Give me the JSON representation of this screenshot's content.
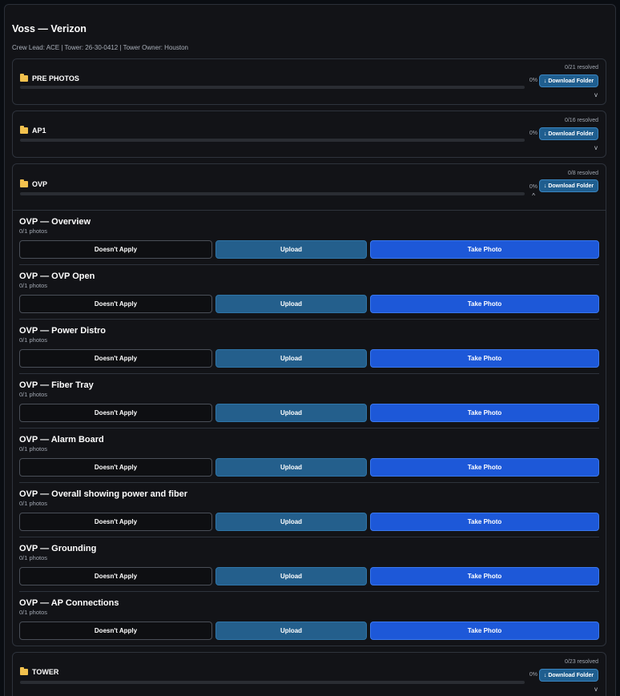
{
  "job": {
    "title": "Voss — Verizon",
    "meta": "Crew Lead: ACE | Tower: 26-30-0412 | Tower Owner: Houston"
  },
  "common": {
    "download_label": "↓ Download Folder",
    "doesnt_apply_label": "Doesn't Apply",
    "upload_label": "Upload",
    "take_photo_label": "Take Photo"
  },
  "folders": [
    {
      "name": "PRE PHOTOS",
      "resolved": "0/21 resolved",
      "percent": "0%",
      "progress": 0,
      "chevron": "v"
    },
    {
      "name": "AP1",
      "resolved": "0/16 resolved",
      "percent": "0%",
      "progress": 0,
      "chevron": "v"
    },
    {
      "name": "OVP",
      "resolved": "0/8 resolved",
      "percent": "0%",
      "progress": 0,
      "chevron": "^",
      "items": [
        {
          "title": "OVP — Overview",
          "count": "0/1 photos"
        },
        {
          "title": "OVP — OVP Open",
          "count": "0/1 photos"
        },
        {
          "title": "OVP — Power Distro",
          "count": "0/1 photos"
        },
        {
          "title": "OVP — Fiber Tray",
          "count": "0/1 photos"
        },
        {
          "title": "OVP — Alarm Board",
          "count": "0/1 photos"
        },
        {
          "title": "OVP — Overall showing power and fiber",
          "count": "0/1 photos"
        },
        {
          "title": "OVP — Grounding",
          "count": "0/1 photos"
        },
        {
          "title": "OVP — AP Connections",
          "count": "0/1 photos"
        }
      ]
    },
    {
      "name": "TOWER",
      "resolved": "0/23 resolved",
      "percent": "0%",
      "progress": 0,
      "chevron": "v"
    }
  ],
  "icons": {
    "folder": "folder-icon",
    "download": "download-icon",
    "chevron": "chevron-icon"
  },
  "colors": {
    "accent": "#1d58d8",
    "upload": "#245f8c",
    "folder": "#f2c14e",
    "background": "#0a0d12"
  }
}
